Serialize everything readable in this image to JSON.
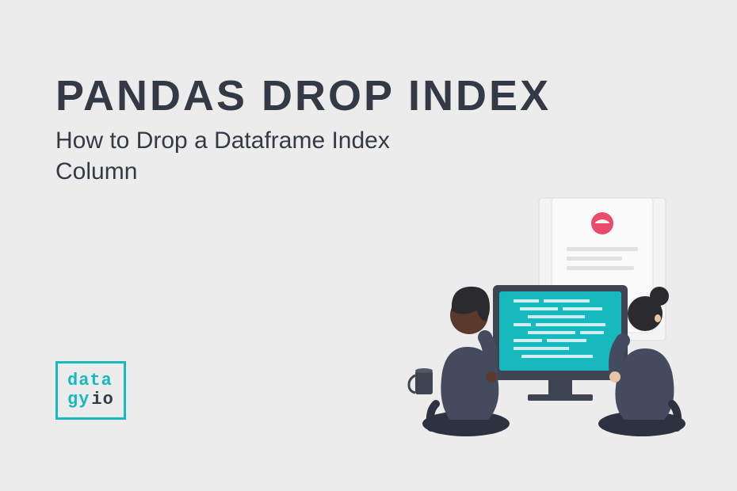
{
  "title": "PANDAS DROP INDEX",
  "subtitle": "How to Drop a Dataframe Index Column",
  "logo": {
    "line1_prefix": "data",
    "line2_prefix": "gy",
    "suffix": "io"
  },
  "colors": {
    "accent": "#17b8be",
    "dark": "#343a45",
    "pink": "#e94b6a"
  }
}
